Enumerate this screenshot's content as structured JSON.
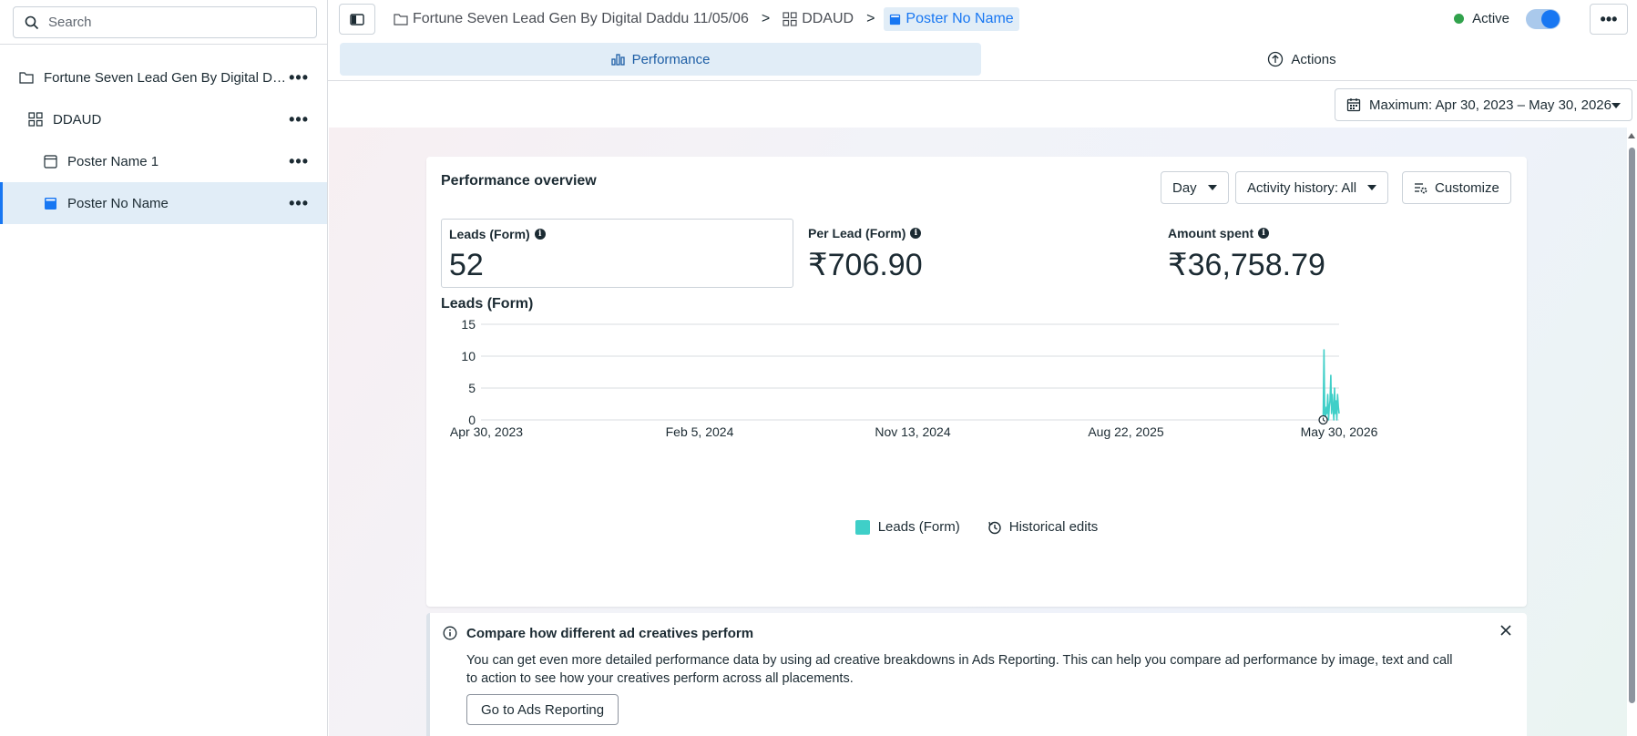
{
  "sidebar": {
    "search_placeholder": "Search",
    "items": [
      {
        "label": "Fortune Seven Lead Gen By Digital Daddu 11/05/06",
        "icon": "folder-icon"
      },
      {
        "label": "DDAUD",
        "icon": "grid-icon"
      },
      {
        "label": "Poster Name 1",
        "icon": "ad-icon"
      },
      {
        "label": "Poster No Name",
        "icon": "ad-icon-filled",
        "active": true
      }
    ]
  },
  "breadcrumb": {
    "campaign": "Fortune Seven Lead Gen By Digital Daddu 11/05/06",
    "adset": "DDAUD",
    "ad": "Poster No Name"
  },
  "header": {
    "status": "Active",
    "status_color": "#31a24c",
    "toggle_on": true
  },
  "tabs": {
    "performance": "Performance",
    "actions": "Actions"
  },
  "date_range": "Maximum: Apr 30, 2023 – May 30, 2026",
  "overview": {
    "title": "Performance overview",
    "granularity": "Day",
    "activity": "Activity history: All",
    "customize": "Customize",
    "metrics": [
      {
        "label": "Leads (Form)",
        "value": "52"
      },
      {
        "label": "Per Lead (Form)",
        "value": "₹706.90"
      },
      {
        "label": "Amount spent",
        "value": "₹36,758.79"
      }
    ],
    "chart_title": "Leads (Form)",
    "legend_leads": "Leads (Form)",
    "legend_history": "Historical edits"
  },
  "chart_data": {
    "type": "line",
    "title": "Leads (Form)",
    "ylim": [
      0,
      20
    ],
    "yticks": [
      0,
      5,
      10,
      15,
      20
    ],
    "xtick_labels": [
      "Apr 30, 2023",
      "Feb 5, 2024",
      "Nov 13, 2024",
      "Aug 22, 2025",
      "May 30, 2026"
    ],
    "x_range": [
      "2023-04-30",
      "2026-05-30"
    ],
    "series": [
      {
        "name": "Leads (Form)",
        "color": "#3fcfc8",
        "x": [
          "2026-05-09",
          "2026-05-10",
          "2026-05-11",
          "2026-05-12",
          "2026-05-13",
          "2026-05-14",
          "2026-05-15",
          "2026-05-16",
          "2026-05-17",
          "2026-05-18",
          "2026-05-19",
          "2026-05-20",
          "2026-05-21",
          "2026-05-22",
          "2026-05-23",
          "2026-05-24",
          "2026-05-25",
          "2026-05-26",
          "2026-05-27",
          "2026-05-28",
          "2026-05-29",
          "2026-05-30"
        ],
        "y": [
          0,
          11,
          1,
          0,
          2,
          1,
          4,
          0,
          2,
          3,
          7,
          1,
          4,
          2,
          0,
          5,
          1,
          3,
          0,
          4,
          2,
          1
        ]
      }
    ],
    "historical_edit_markers": [
      "2026-05-09"
    ],
    "grid": true,
    "legend": "bottom-center"
  },
  "banner": {
    "title": "Compare how different ad creatives perform",
    "text": "You can get even more detailed performance data by using ad creative breakdowns in Ads Reporting. This can help you compare ad performance by image, text and call to action to see how your creatives perform across all placements.",
    "button": "Go to Ads Reporting"
  }
}
